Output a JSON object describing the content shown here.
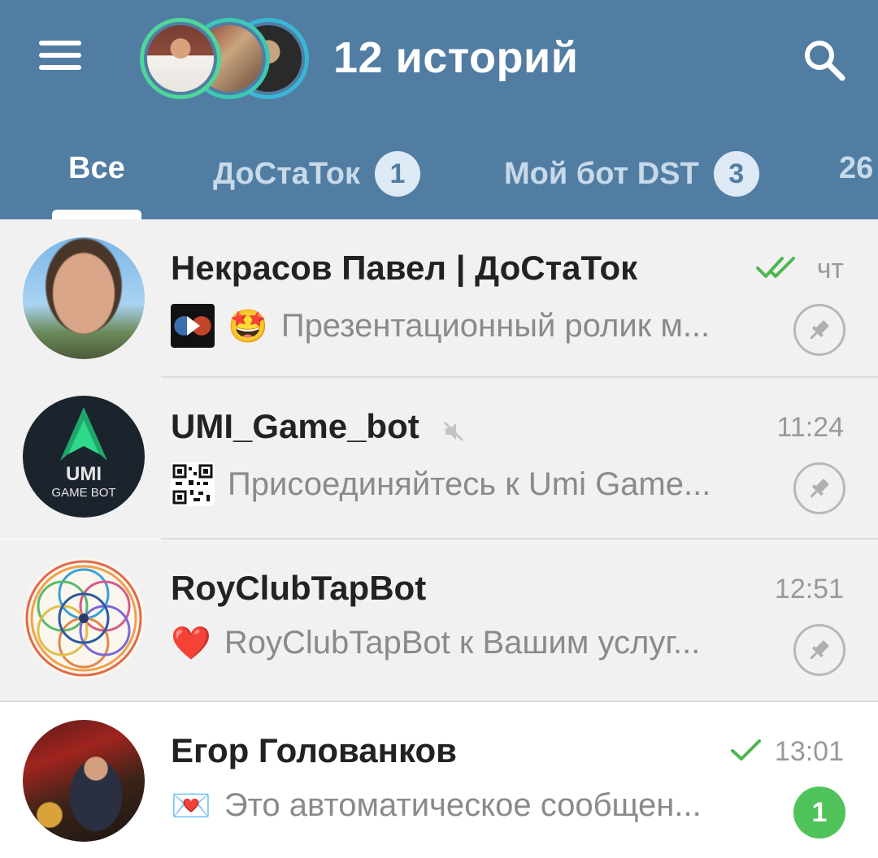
{
  "header": {
    "title": "12 историй",
    "menu_icon": "hamburger-menu-icon",
    "search_icon": "search-icon",
    "color": "#527da3"
  },
  "tabs": [
    {
      "label": "Все",
      "active": true
    },
    {
      "label": "ДоСтаТок",
      "badge": "1"
    },
    {
      "label": "Мой бот DST",
      "badge": "3"
    },
    {
      "label": "26"
    }
  ],
  "chats": [
    {
      "name": "Некрасов Павел | ДоСтаТок",
      "time": "чт",
      "status": "read",
      "preview_emoji": "🤩",
      "preview": "Презентационный ролик м...",
      "pinned": true
    },
    {
      "name": "UMI_Game_bot",
      "muted": true,
      "time": "11:24",
      "avatar_text_1": "UMI",
      "avatar_text_2": "GAME BOT",
      "preview": "Присоединяйтесь к Umi Game...",
      "pinned": true
    },
    {
      "name": "RoyClubTapBot",
      "time": "12:51",
      "preview_emoji": "❤️",
      "preview": "RoyClubTapBot к Вашим услуг...",
      "pinned": true
    },
    {
      "name": "Егор Голованков",
      "time": "13:01",
      "status": "sent",
      "preview_emoji": "💌",
      "preview": "Это автоматическое сообщен...",
      "unread": "1"
    }
  ]
}
